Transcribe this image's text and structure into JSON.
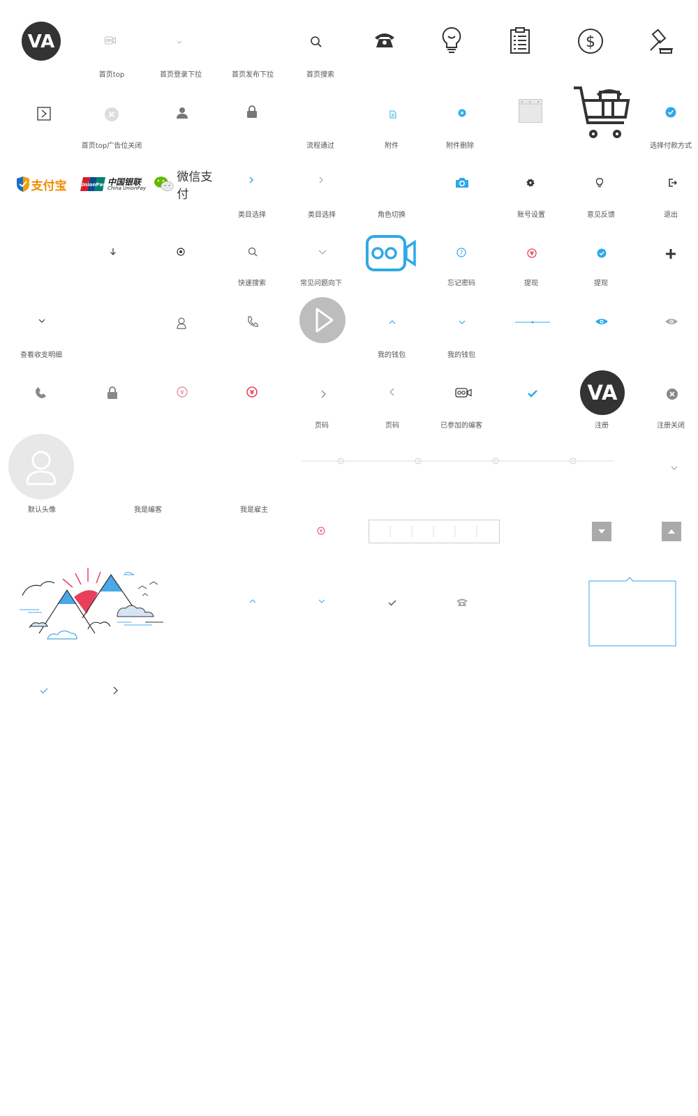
{
  "colors": {
    "accent": "#2fa8e8",
    "dark": "#333333",
    "gray": "#888888",
    "red": "#e8405a",
    "border": "#cfcfcf"
  },
  "labels": {
    "l1": "首页top",
    "l2": "首页登录下拉",
    "l3": "首页发布下拉",
    "l4": "首页搜索",
    "l5": "首页top广告位关闭",
    "l6": "流程通过",
    "l7": "附件",
    "l8": "附件删除",
    "l9": "选择付款方式",
    "l10": "类目选择",
    "l11": "类目选择",
    "l12": "角色切换",
    "l13": "账号设置",
    "l14": "意见反馈",
    "l15": "退出",
    "l16": "快速搜索",
    "l17": "常见问题向下",
    "l18": "忘记密码",
    "l19": "提现",
    "l20": "提现",
    "l21": "查看收支明细",
    "l22": "我的钱包",
    "l23": "我的钱包",
    "l24": "页码",
    "l25": "页码",
    "l26": "已参加的编客",
    "l27": "注册",
    "l28": "注册关闭",
    "l29": "默认头像",
    "l30": "我是编客",
    "l31": "我是雇主"
  },
  "logo": {
    "text": "VA"
  },
  "payments": {
    "alipay": "支付宝",
    "unionpay_cn": "中国银联",
    "unionpay_en": "China UnionPay",
    "unionpay_badge": "UnionPay",
    "wechat": "微信支付"
  },
  "icons": [
    "logo-icon",
    "video-small-icon",
    "chevron-down-icon",
    "search-icon",
    "telephone-icon",
    "lightbulb-icon",
    "clipboard-icon",
    "dollar-icon",
    "gavel-icon",
    "expand-box-icon",
    "close-circle-icon",
    "user-icon",
    "lock-icon",
    "file-icon",
    "close-dot-icon",
    "window-icon",
    "cart-icon",
    "check-circle-icon",
    "alipay-logo",
    "unionpay-logo",
    "wechat-pay-logo",
    "chevron-right-icon",
    "camera-icon",
    "gear-icon",
    "bulb-small-icon",
    "logout-icon",
    "arrow-down-icon",
    "location-icon",
    "question-icon",
    "cash-icon",
    "plus-icon",
    "user-outline-icon",
    "phone-outline-icon",
    "play-icon",
    "chevron-up-icon",
    "eye-closed-icon",
    "eye-icon",
    "check-icon",
    "avatar-icon",
    "mountain-illustration",
    "dropdown-button-icon",
    "dropup-button-icon",
    "tooltip-box"
  ]
}
